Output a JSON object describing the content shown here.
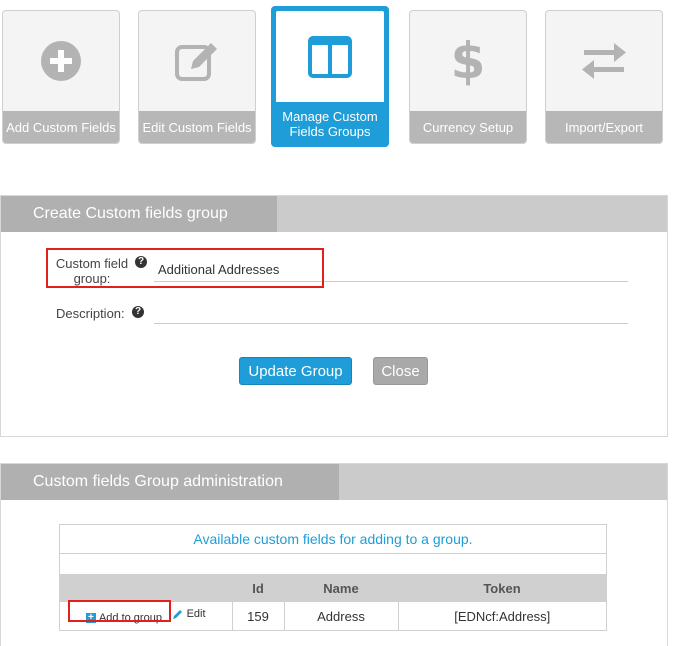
{
  "toolbar": {
    "tiles": [
      {
        "label": "Add Custom Fields",
        "icon": "plus-circle-icon"
      },
      {
        "label": "Edit Custom Fields",
        "icon": "edit-icon"
      },
      {
        "label": "Manage Custom Fields Groups",
        "icon": "columns-icon"
      },
      {
        "label": "Currency Setup",
        "icon": "dollar-icon"
      },
      {
        "label": "Import/Export",
        "icon": "exchange-icon"
      }
    ]
  },
  "create_panel": {
    "title": "Create Custom fields group",
    "group_label": "Custom field group:",
    "group_value": "Additional Addresses",
    "description_label": "Description:",
    "description_value": "",
    "help_glyph": "?",
    "update_button": "Update Group",
    "close_button": "Close"
  },
  "admin_panel": {
    "title": "Custom fields Group administration",
    "caption": "Available custom fields for adding to a group.",
    "columns": [
      "",
      "Id",
      "Name",
      "Token"
    ],
    "rows": [
      {
        "add_label": "Add to group",
        "edit_label": "Edit",
        "id": "159",
        "name": "Address",
        "token": "[EDNcf:Address]"
      }
    ]
  },
  "colors": {
    "accent": "#1e9dd8",
    "highlight": "#e01f1f",
    "tile_label": "#b7b7b7"
  }
}
